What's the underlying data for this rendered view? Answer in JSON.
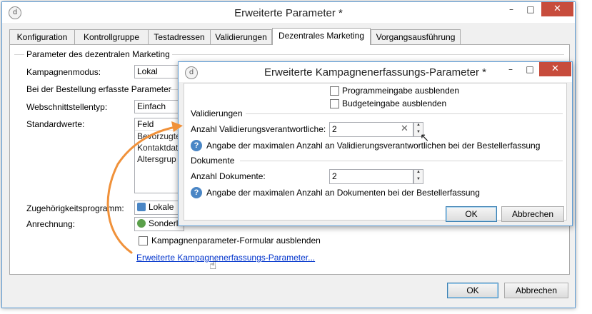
{
  "main_window": {
    "title": "Erweiterte Parameter *",
    "icon": "app-logo-icon",
    "tabs": [
      {
        "label": "Konfiguration"
      },
      {
        "label": "Kontrollgruppe"
      },
      {
        "label": "Testadressen"
      },
      {
        "label": "Validierungen"
      },
      {
        "label": "Dezentrales Marketing",
        "active": true
      },
      {
        "label": "Vorgangsausführung"
      }
    ],
    "group_label": "Parameter des dezentralen Marketing",
    "campaign_mode_label": "Kampagnenmodus:",
    "campaign_mode_value": "Lokal",
    "order_params_label": "Bei der Bestellung erfasste Parameter",
    "interface_type_label": "Webschnittstellentyp:",
    "interface_type_value": "Einfach",
    "defaults_label": "Standardwerte:",
    "defaults_list": [
      "Feld",
      "Bevorzugte",
      "Kontaktdat",
      "Altersgrup"
    ],
    "program_label": "Zugehörigkeitsprogramm:",
    "program_value": "Lokale",
    "charging_label": "Anrechnung:",
    "charging_value": "Sonderl",
    "hide_form_label": "Kampagnenparameter-Formular ausblenden",
    "advanced_link": "Erweiterte Kampagnenerfassungs-Parameter...",
    "ok_label": "OK",
    "cancel_label": "Abbrechen"
  },
  "dialog": {
    "title": "Erweiterte Kampagnenerfassungs-Parameter *",
    "hide_program_label": "Programmeingabe ausblenden",
    "hide_budget_label": "Budgeteingabe ausblenden",
    "validations_section": "Validierungen",
    "approvers_label": "Anzahl Validierungsverantwortliche:",
    "approvers_value": "2",
    "approvers_help": "Angabe der maximalen Anzahl an Validierungsverantwortlichen bei der Bestellerfassung",
    "documents_section": "Dokumente",
    "documents_label": "Anzahl Dokumente:",
    "documents_value": "2",
    "documents_help": "Angabe der maximalen Anzahl an Dokumenten bei der Bestellerfassung",
    "ok_label": "OK",
    "cancel_label": "Abbrechen"
  },
  "window_controls": {
    "minimize": "–",
    "maximize": "□",
    "close": "✕"
  },
  "colors": {
    "accent": "#5b9bd5",
    "close": "#c74c3c",
    "arrow": "#f0913a",
    "link": "#0033cc"
  }
}
